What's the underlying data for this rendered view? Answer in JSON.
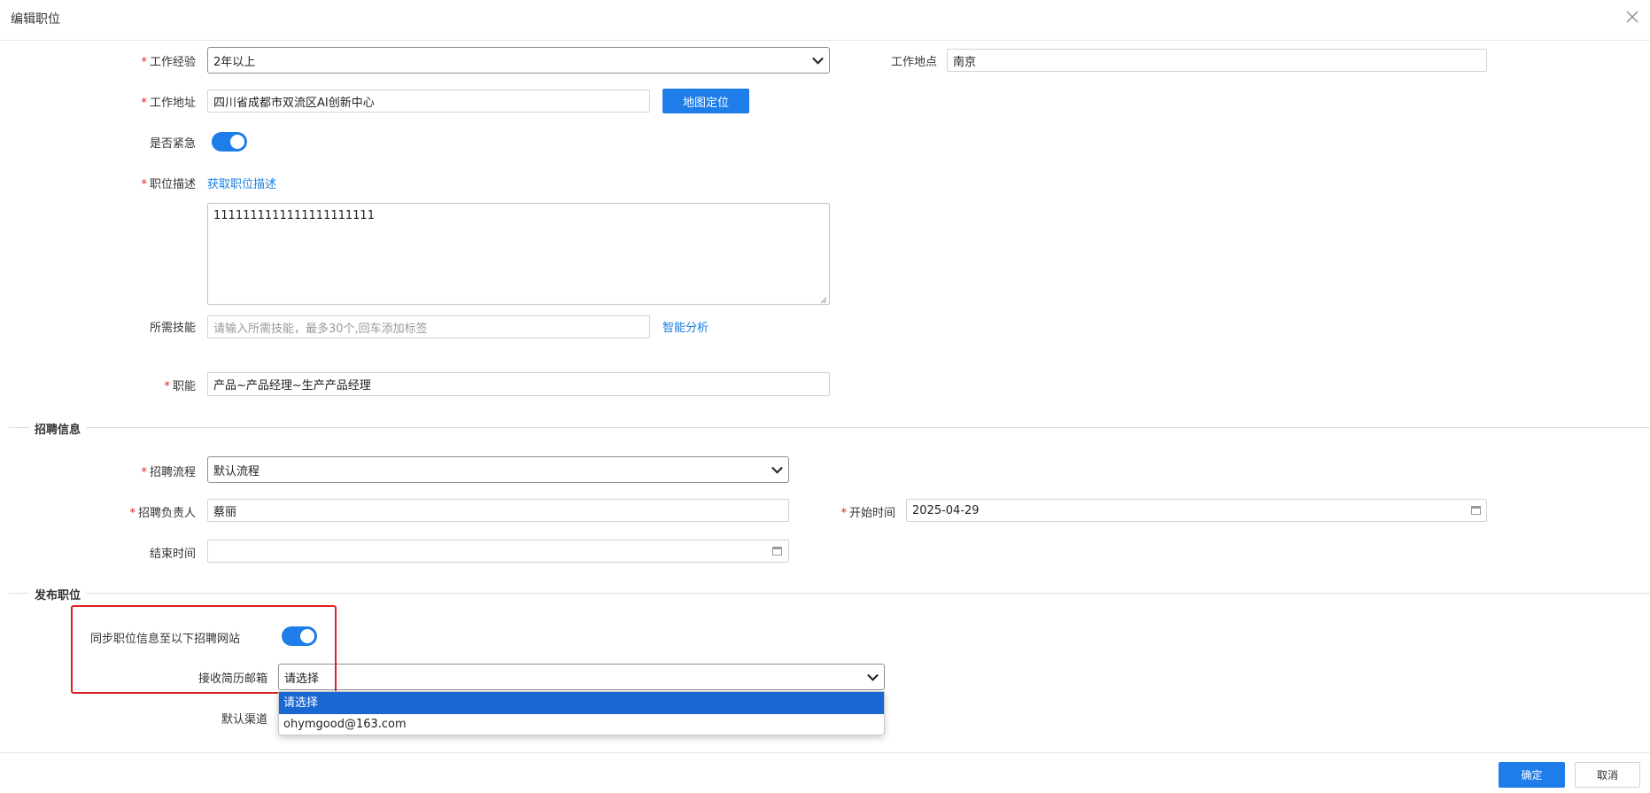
{
  "dialog": {
    "title": "编辑职位",
    "close_icon": "close-icon"
  },
  "form": {
    "experience": {
      "label": "工作经验",
      "value": "2年以上"
    },
    "location": {
      "label": "工作地点",
      "value": "南京"
    },
    "address": {
      "label": "工作地址",
      "value": "四川省成都市双流区AI创新中心",
      "map_button": "地图定位"
    },
    "urgent": {
      "label": "是否紧急",
      "on": true
    },
    "description": {
      "label": "职位描述",
      "link": "获取职位描述",
      "value": "1111111111111111111111"
    },
    "skills": {
      "label": "所需技能",
      "placeholder": "请输入所需技能，最多30个,回车添加标签",
      "link": "智能分析"
    },
    "function": {
      "label": "职能",
      "value": "产品~产品经理~生产产品经理"
    }
  },
  "recruit": {
    "section_title": "招聘信息",
    "process": {
      "label": "招聘流程",
      "value": "默认流程"
    },
    "owner": {
      "label": "招聘负责人",
      "value": "蔡丽"
    },
    "start_time": {
      "label": "开始时间",
      "value": "2025-04-29"
    },
    "end_time": {
      "label": "结束时间",
      "value": ""
    }
  },
  "publish": {
    "section_title": "发布职位",
    "sync": {
      "label": "同步职位信息至以下招聘网站",
      "on": true
    },
    "email": {
      "label": "接收简历邮箱",
      "value": "请选择",
      "options": [
        "请选择",
        "ohymgood@163.com"
      ]
    },
    "channel": {
      "label": "默认渠道"
    }
  },
  "footer": {
    "confirm": "确定",
    "cancel": "取消"
  },
  "colors": {
    "accent": "#1e7de8",
    "highlight_box": "#e0201f",
    "required": "#e0201f"
  }
}
